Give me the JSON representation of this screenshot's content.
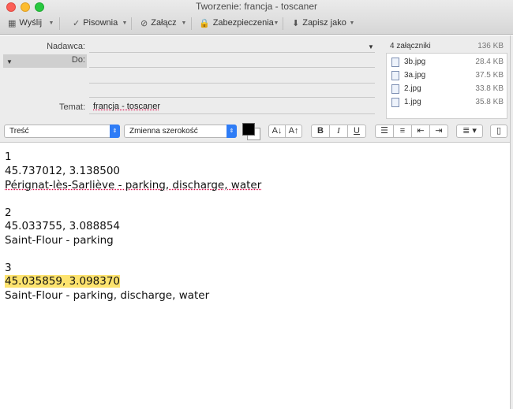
{
  "window": {
    "title": "Tworzenie: francja - toscaner"
  },
  "toolbar": {
    "send": "Wyślij",
    "spelling": "Pisownia",
    "attach": "Załącz",
    "security": "Zabezpieczenia",
    "save_as": "Zapisz jako"
  },
  "header": {
    "from_label": "Nadawca:",
    "to_label": "Do:",
    "subject_label": "Temat:",
    "subject_value": "francja - toscaner"
  },
  "attachments": {
    "heading": "4 załączniki",
    "total_size": "136 KB",
    "items": [
      {
        "name": "3b.jpg",
        "size": "28.4 KB"
      },
      {
        "name": "3a.jpg",
        "size": "37.5 KB"
      },
      {
        "name": "2.jpg",
        "size": "33.8 KB"
      },
      {
        "name": "1.jpg",
        "size": "35.8 KB"
      }
    ]
  },
  "format": {
    "style_select": "Treść",
    "font_select": "Zmienna szerokość",
    "font_smaller": "A↓",
    "font_larger": "A↑",
    "bold": "B",
    "italic": "I",
    "underline": "U"
  },
  "body": {
    "lines": [
      "1",
      "45.737012, 3.138500",
      "Pérignat-lès-Sarliève - parking, discharge, water",
      "2",
      "45.033755, 3.088854",
      "Saint-Flour - parking",
      "3",
      "45.035859, 3.098370",
      "Saint-Flour - parking, discharge, water"
    ]
  },
  "colors": {
    "highlight": "#fde36e",
    "accent": "#2e7cf6"
  }
}
